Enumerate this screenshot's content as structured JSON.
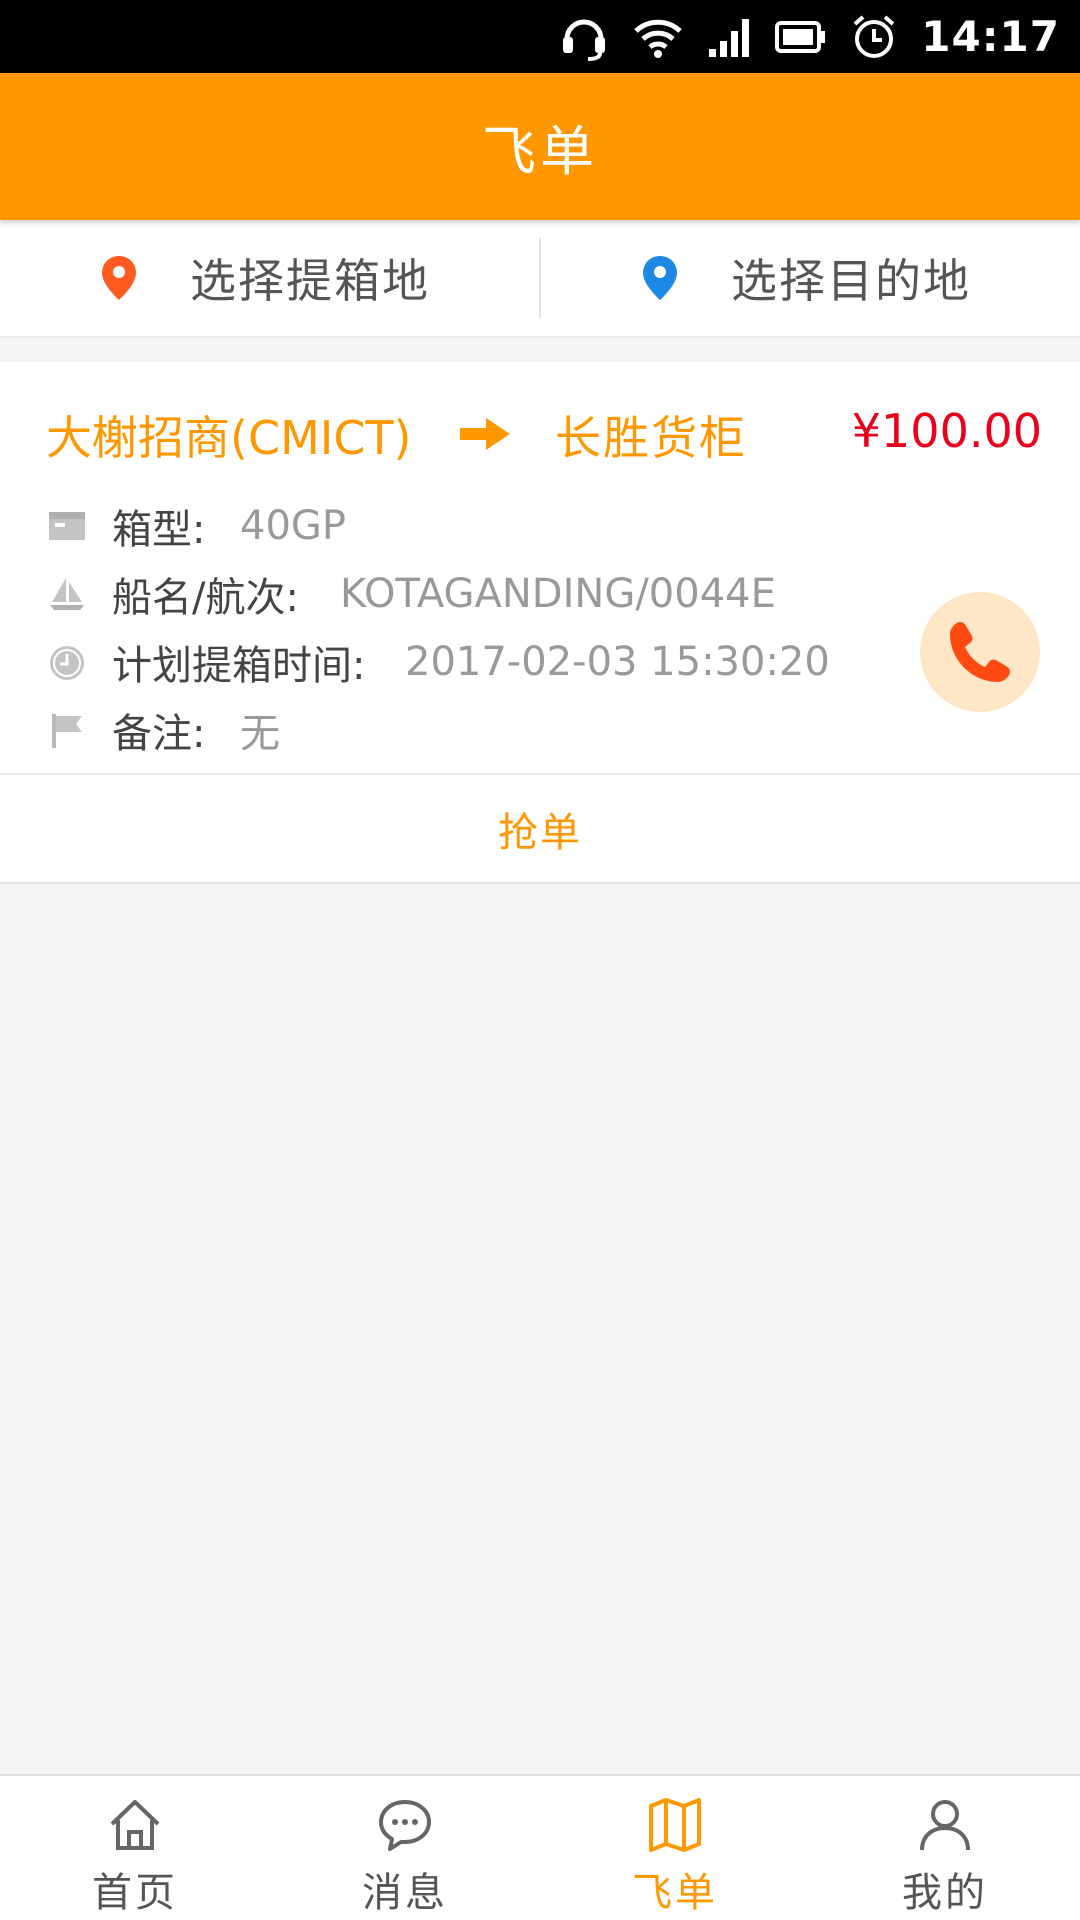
{
  "status_bar": {
    "time": "14:17",
    "icons": [
      "headset-icon",
      "wifi-icon",
      "signal-icon",
      "battery-icon",
      "alarm-icon"
    ]
  },
  "header": {
    "title": "飞单"
  },
  "location_bar": {
    "pickup_label": "选择提箱地",
    "pickup_icon_color": "#ff5a1f",
    "destination_label": "选择目的地",
    "destination_icon_color": "#1e88e5"
  },
  "order": {
    "from": "大榭招商(CMICT)",
    "to": "长胜货柜",
    "price": "¥100.00",
    "container_type_label": "箱型:",
    "container_type_value": "40GP",
    "vessel_label": "船名/航次:",
    "vessel_value": "KOTAGANDING/0044E",
    "pickup_time_label": "计划提箱时间:",
    "pickup_time_value": "2017-02-03  15:30:20",
    "remark_label": "备注:",
    "remark_value": "无",
    "grab_button": "抢单"
  },
  "bottom_nav": {
    "items": [
      {
        "label": "首页",
        "icon": "home-icon"
      },
      {
        "label": "消息",
        "icon": "chat-icon"
      },
      {
        "label": "飞单",
        "icon": "map-icon",
        "active": true
      },
      {
        "label": "我的",
        "icon": "user-icon"
      }
    ]
  },
  "colors": {
    "accent": "#ff9800",
    "price": "#e8001c"
  }
}
